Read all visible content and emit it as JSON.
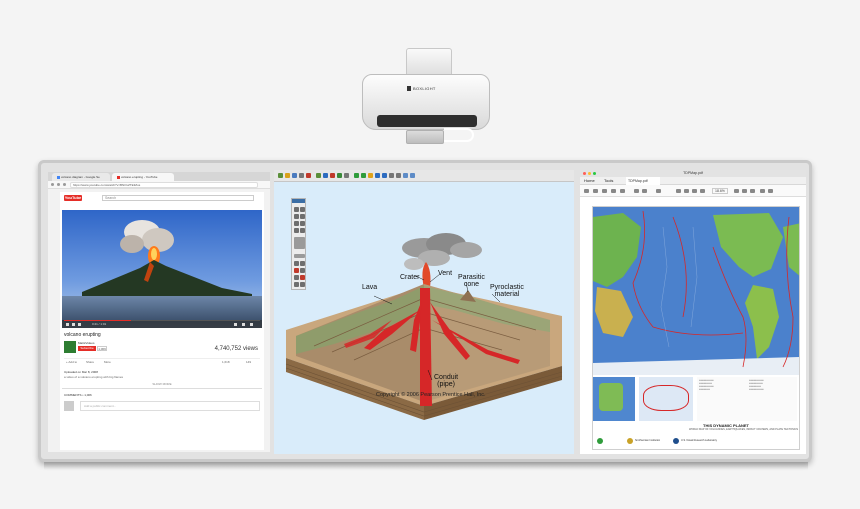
{
  "projector": {
    "brand": "BOXLIGHT"
  },
  "youtube": {
    "tabs": [
      "volcano diagram - Google Se",
      "volcano erupting - YouTube"
    ],
    "url": "https://www.youtube.com/watch?v=BNOxZTE3Zus",
    "logo": "YouTube",
    "search_placeholder": "Search",
    "video_time": "0:21 / 1:01",
    "video_title": "volcano erupting",
    "channel": "MattsVideos",
    "subscribe": "Subscribe",
    "subscriber_count": "1,069",
    "views": "4,740,752 views",
    "actions": [
      "+ Add to",
      "Share",
      "More"
    ],
    "likes": "1,618",
    "dislikes": "149",
    "upload_date": "Uploaded on Mar 8, 2008",
    "description": "a video of a volcano erupting with big flames",
    "show_more": "SHOW MORE",
    "comments_header": "COMMENTS • 1,006",
    "comment_placeholder": "Add a public comment..."
  },
  "volcano": {
    "labels": {
      "crater": "Crater",
      "vent": "Vent",
      "lava": "Lava",
      "parasitic_cone": "Parasitic\ncone",
      "pyroclastic": "Pyroclastic\nmaterial",
      "conduit": "Conduit\n(pipe)"
    },
    "copyright": "Copyright © 2006 Pearson Prentice Hall, Inc."
  },
  "map_viewer": {
    "title": "TDPMap.pdf",
    "menu": [
      "Home",
      "Tools"
    ],
    "tab": "TDPMap.pdf",
    "zoom": "18.6%",
    "planet_title": "THIS DYNAMIC PLANET",
    "planet_subtitle": "WORLD MAP OF VOLCANOES, EARTHQUAKES, IMPACT CRATERS, AND PLATE TECTONICS",
    "logos": [
      "Smithsonian Institution",
      "U.S. Naval Research Laboratory"
    ]
  },
  "colors": {
    "youtube_red": "#e52d27",
    "diagram_bg": "#d9ecfa",
    "lava": "#d62728",
    "ocean": "#3a6fc2"
  }
}
